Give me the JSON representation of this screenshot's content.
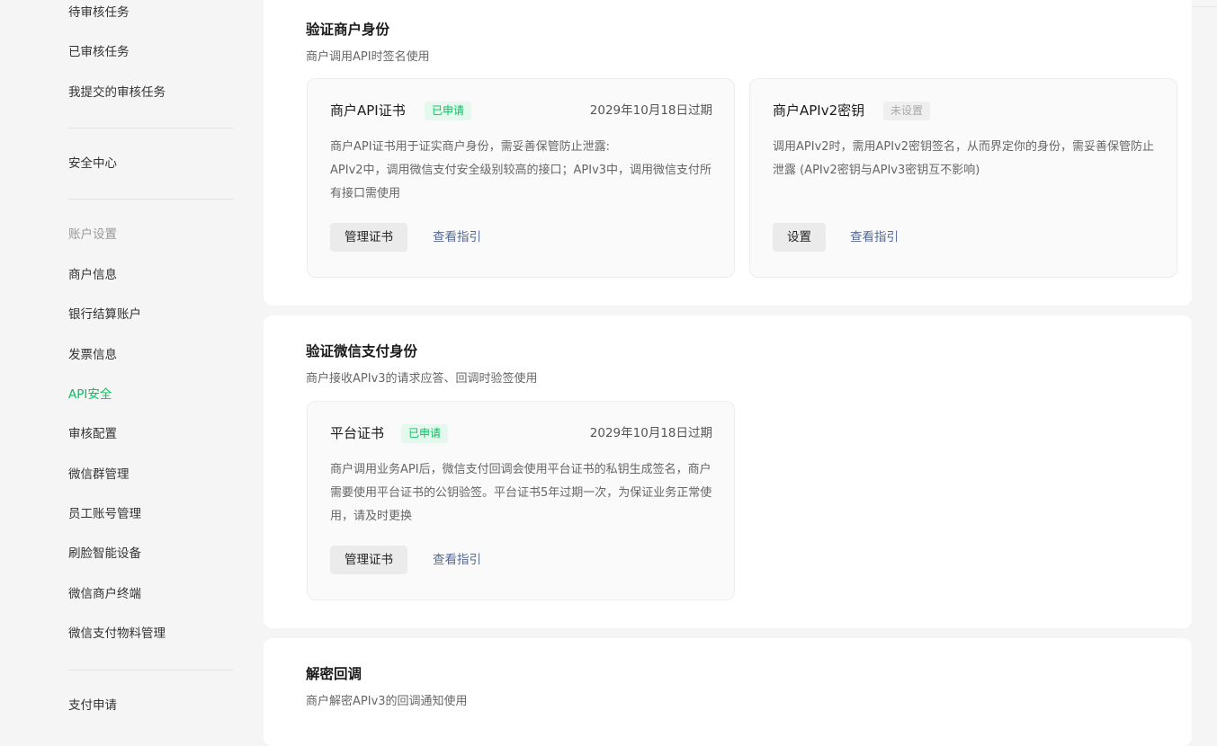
{
  "sidebar": {
    "items_top": [
      "待审核任务",
      "已审核任务",
      "我提交的审核任务"
    ],
    "security_center": "安全中心",
    "account_group_label": "账户设置",
    "account_items": [
      "商户信息",
      "银行结算账户",
      "发票信息",
      "API安全",
      "审核配置",
      "微信群管理",
      "员工账号管理",
      "刷脸智能设备",
      "微信商户终端",
      "微信支付物料管理"
    ],
    "active_item": "API安全",
    "bottom_item": "支付申请"
  },
  "section1": {
    "title": "验证商户身份",
    "subtitle": "商户调用API时签名使用",
    "card_cert": {
      "title": "商户API证书",
      "badge": "已申请",
      "date": "2029年10月18日过期",
      "desc_line1": "商户API证书用于证实商户身份，需妥善保管防止泄露:",
      "desc_line2": "APIv2中，调用微信支付安全级别较高的接口；APIv3中，调用微信支付所有接口需使用",
      "button": "管理证书",
      "link": "查看指引"
    },
    "card_key": {
      "title": "商户APIv2密钥",
      "badge": "未设置",
      "desc": "调用APIv2时，需用APIv2密钥签名，从而界定你的身份，需妥善保管防止泄露 (APIv2密钥与APIv3密钥互不影响)",
      "button": "设置",
      "link": "查看指引"
    }
  },
  "section2": {
    "title": "验证微信支付身份",
    "subtitle": "商户接收APIv3的请求应答、回调时验签使用",
    "card_platform": {
      "title": "平台证书",
      "badge": "已申请",
      "date": "2029年10月18日过期",
      "desc": "商户调用业务API后，微信支付回调会使用平台证书的私钥生成签名，商户需要使用平台证书的公钥验签。平台证书5年过期一次，为保证业务正常使用，请及时更换",
      "button": "管理证书",
      "link": "查看指引"
    }
  },
  "section3": {
    "title": "解密回调",
    "subtitle": "商户解密APIv3的回调通知使用"
  },
  "colors": {
    "accent": "#07c160",
    "link": "#576b95",
    "badge_on_bg": "#e5f8ee",
    "badge_off_bg": "#efefef"
  }
}
